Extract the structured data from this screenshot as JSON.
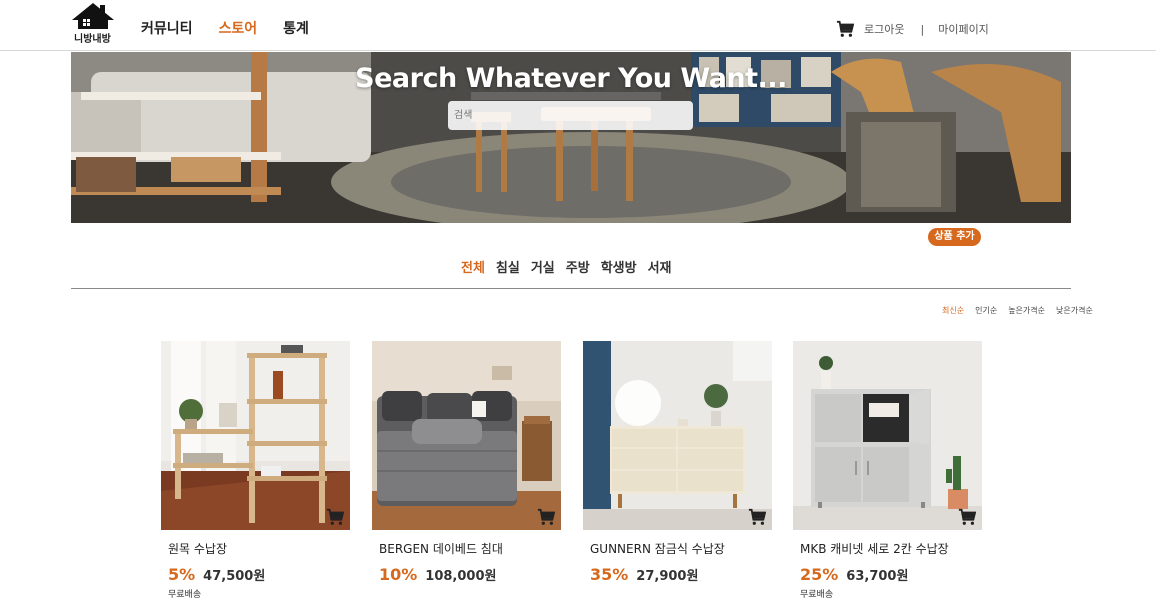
{
  "header": {
    "logo_text": "니방내방",
    "nav": [
      {
        "label": "커뮤니티",
        "active": false
      },
      {
        "label": "스토어",
        "active": true
      },
      {
        "label": "통계",
        "active": false
      }
    ],
    "logout_label": "로그아웃",
    "separator": "|",
    "mypage_label": "마이페이지"
  },
  "hero": {
    "title": "Search Whatever You Want...",
    "search_placeholder": "검색"
  },
  "add_product_label": "상품 추가",
  "categories": [
    {
      "label": "전체",
      "active": true
    },
    {
      "label": "침실",
      "active": false
    },
    {
      "label": "거실",
      "active": false
    },
    {
      "label": "주방",
      "active": false
    },
    {
      "label": "학생방",
      "active": false
    },
    {
      "label": "서재",
      "active": false
    }
  ],
  "sort_options": [
    {
      "label": "최신순",
      "active": true
    },
    {
      "label": "인기순",
      "active": false
    },
    {
      "label": "높은가격순",
      "active": false
    },
    {
      "label": "낮은가격순",
      "active": false
    }
  ],
  "products": [
    {
      "name": "원목 수납장",
      "discount": "5%",
      "price": "47,500원",
      "shipping": "무료배송"
    },
    {
      "name": "BERGEN 데이베드 침대",
      "discount": "10%",
      "price": "108,000원",
      "shipping": ""
    },
    {
      "name": "GUNNERN 잠금식 수납장",
      "discount": "35%",
      "price": "27,900원",
      "shipping": ""
    },
    {
      "name": "MKB 캐비넷 세로 2칸 수납장",
      "discount": "25%",
      "price": "63,700원",
      "shipping": "무료배송"
    }
  ],
  "colors": {
    "accent": "#d6691e",
    "text": "#222222"
  },
  "icons": {
    "cart": "shopping-cart-icon",
    "logo": "house-icon"
  }
}
